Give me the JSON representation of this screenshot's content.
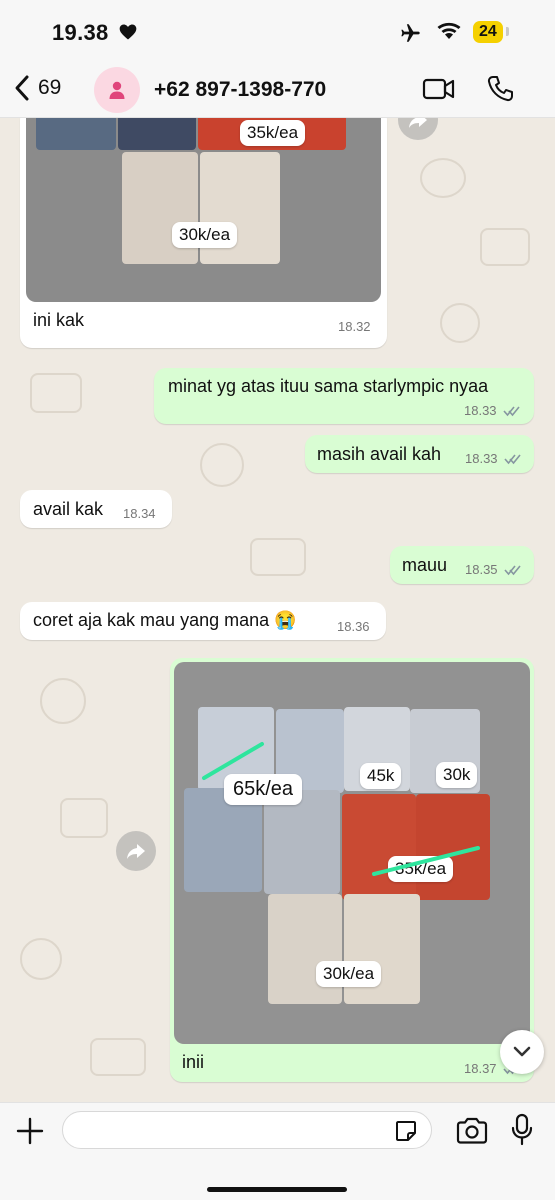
{
  "status_bar": {
    "time": "19.38",
    "battery": "24",
    "icons": [
      "heart-icon",
      "airplane-icon",
      "wifi-icon",
      "battery-icon"
    ]
  },
  "header": {
    "back_count": "69",
    "contact": "+62 897-1398-770",
    "icons": [
      "chevron-left-icon",
      "person-icon",
      "video-camera-icon",
      "phone-icon"
    ]
  },
  "messages": [
    {
      "id": "m1",
      "direction": "incoming",
      "type": "image",
      "caption": "ini kak",
      "time": "18.32",
      "price_tags": [
        "35k/ea",
        "30k/ea"
      ]
    },
    {
      "id": "m2",
      "direction": "outgoing",
      "text": "minat yg atas ituu sama starlympic nyaa",
      "time": "18.33",
      "status": "read"
    },
    {
      "id": "m3",
      "direction": "outgoing",
      "text": "masih avail kah",
      "time": "18.33",
      "status": "read"
    },
    {
      "id": "m4",
      "direction": "incoming",
      "text": "avail kak",
      "time": "18.34"
    },
    {
      "id": "m5",
      "direction": "outgoing",
      "text": "mauu",
      "time": "18.35",
      "status": "read"
    },
    {
      "id": "m6",
      "direction": "incoming",
      "text": "coret aja kak mau yang mana 😭",
      "time": "18.36"
    },
    {
      "id": "m7",
      "direction": "outgoing",
      "type": "image",
      "caption": "inii",
      "time": "18.37",
      "status": "read",
      "price_tags": [
        "65k/ea",
        "45k",
        "30k",
        "35k/ea",
        "30k/ea"
      ]
    }
  ],
  "composer": {
    "value": "",
    "icons": [
      "plus-icon",
      "sticker-icon",
      "camera-icon",
      "microphone-icon"
    ]
  },
  "colors": {
    "chat_background": "#efeae2",
    "incoming_bubble": "#ffffff",
    "outgoing_bubble": "#d9fdd3",
    "read_ticks": "#8696a0",
    "highlight_mark": "#2ee59d",
    "avatar_bg": "#fbd8e2",
    "avatar_icon": "#e0457b",
    "battery": "#f5d000"
  }
}
